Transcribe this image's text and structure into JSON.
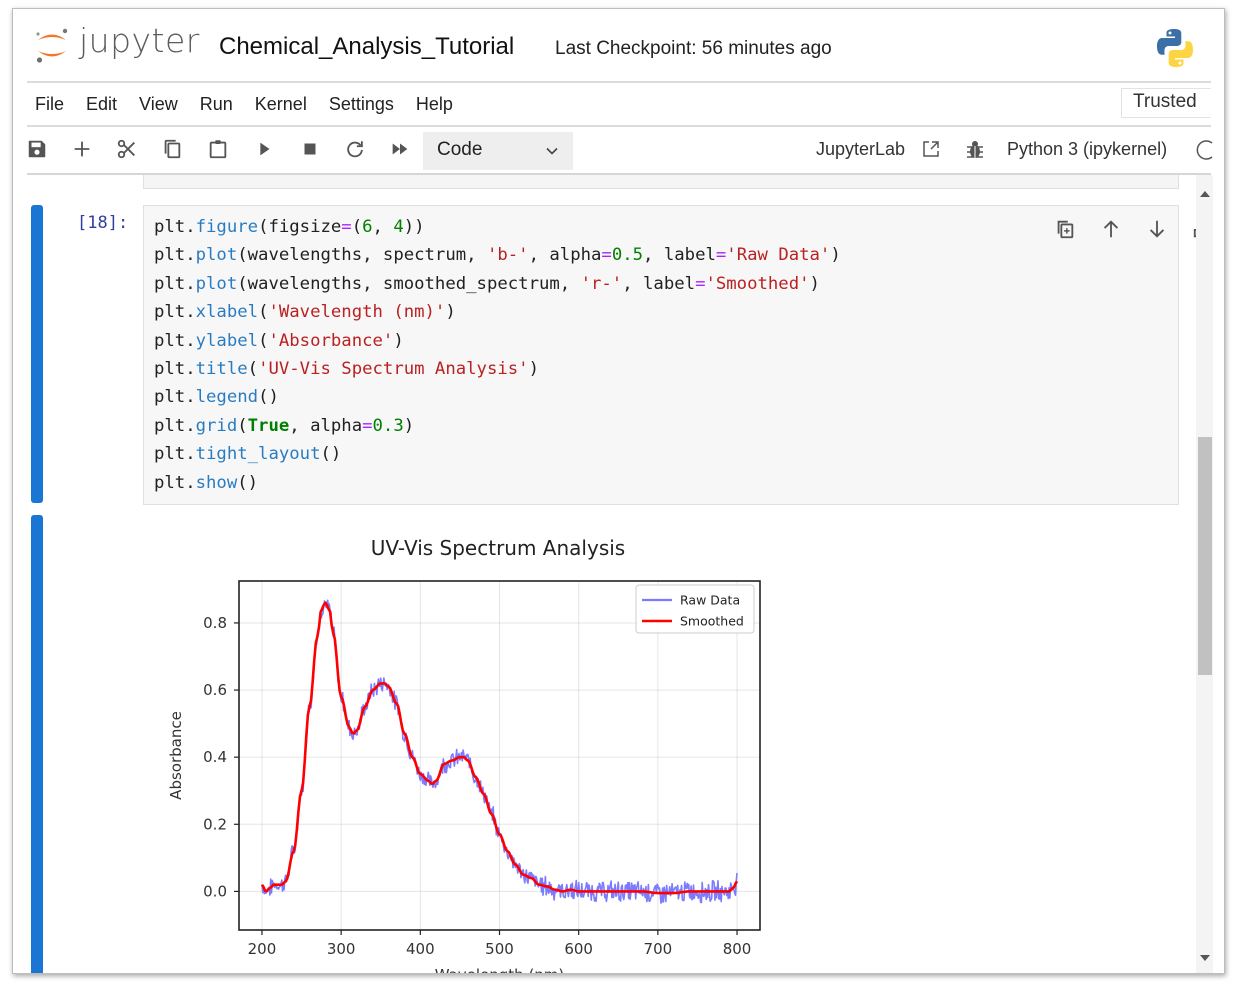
{
  "header": {
    "logo_word": "jupyter",
    "notebook_title": "Chemical_Analysis_Tutorial",
    "checkpoint": "Last Checkpoint: 56 minutes ago"
  },
  "menu": {
    "items": [
      "File",
      "Edit",
      "View",
      "Run",
      "Kernel",
      "Settings",
      "Help"
    ],
    "trusted_label": "Trusted"
  },
  "toolbar": {
    "icons": [
      "save-icon",
      "add-cell-icon",
      "cut-icon",
      "copy-icon",
      "paste-icon",
      "run-icon",
      "stop-icon",
      "restart-icon",
      "run-all-icon"
    ],
    "cell_type": "Code",
    "open_in_label": "JupyterLab",
    "kernel_name": "Python 3 (ipykernel)"
  },
  "cell": {
    "prompt": "[18]:",
    "tools": [
      "duplicate-cell-icon",
      "move-up-icon",
      "move-down-icon",
      "insert-above-icon",
      "insert-below-icon",
      "delete-cell-icon"
    ],
    "code_lines": [
      [
        [
          "plt.",
          "c-def"
        ],
        [
          "figure",
          "c-kw"
        ],
        [
          "(figsize",
          "c-def"
        ],
        [
          "=",
          "c-op"
        ],
        [
          "(",
          "c-def"
        ],
        [
          "6",
          "c-num"
        ],
        [
          ", ",
          "c-def"
        ],
        [
          "4",
          "c-num"
        ],
        [
          "))",
          "c-def"
        ]
      ],
      [
        [
          "plt.",
          "c-def"
        ],
        [
          "plot",
          "c-kw"
        ],
        [
          "(wavelengths, spectrum, ",
          "c-def"
        ],
        [
          "'b-'",
          "c-str"
        ],
        [
          ", alpha",
          "c-def"
        ],
        [
          "=",
          "c-op"
        ],
        [
          "0.5",
          "c-num"
        ],
        [
          ", label",
          "c-def"
        ],
        [
          "=",
          "c-op"
        ],
        [
          "'Raw Data'",
          "c-str"
        ],
        [
          ")",
          "c-def"
        ]
      ],
      [
        [
          "plt.",
          "c-def"
        ],
        [
          "plot",
          "c-kw"
        ],
        [
          "(wavelengths, smoothed_spectrum, ",
          "c-def"
        ],
        [
          "'r-'",
          "c-str"
        ],
        [
          ", label",
          "c-def"
        ],
        [
          "=",
          "c-op"
        ],
        [
          "'Smoothed'",
          "c-str"
        ],
        [
          ")",
          "c-def"
        ]
      ],
      [
        [
          "plt.",
          "c-def"
        ],
        [
          "xlabel",
          "c-kw"
        ],
        [
          "(",
          "c-def"
        ],
        [
          "'Wavelength (nm)'",
          "c-str"
        ],
        [
          ")",
          "c-def"
        ]
      ],
      [
        [
          "plt.",
          "c-def"
        ],
        [
          "ylabel",
          "c-kw"
        ],
        [
          "(",
          "c-def"
        ],
        [
          "'Absorbance'",
          "c-str"
        ],
        [
          ")",
          "c-def"
        ]
      ],
      [
        [
          "plt.",
          "c-def"
        ],
        [
          "title",
          "c-kw"
        ],
        [
          "(",
          "c-def"
        ],
        [
          "'UV-Vis Spectrum Analysis'",
          "c-str"
        ],
        [
          ")",
          "c-def"
        ]
      ],
      [
        [
          "plt.",
          "c-def"
        ],
        [
          "legend",
          "c-kw"
        ],
        [
          "()",
          "c-def"
        ]
      ],
      [
        [
          "plt.",
          "c-def"
        ],
        [
          "grid",
          "c-kw"
        ],
        [
          "(",
          "c-def"
        ],
        [
          "True",
          "c-bool"
        ],
        [
          ", alpha",
          "c-def"
        ],
        [
          "=",
          "c-op"
        ],
        [
          "0.3",
          "c-num"
        ],
        [
          ")",
          "c-def"
        ]
      ],
      [
        [
          "plt.",
          "c-def"
        ],
        [
          "tight_layout",
          "c-kw"
        ],
        [
          "()",
          "c-def"
        ]
      ],
      [
        [
          "plt.",
          "c-def"
        ],
        [
          "show",
          "c-kw"
        ],
        [
          "()",
          "c-def"
        ]
      ]
    ]
  },
  "colors": {
    "accent_blue": "#1976d2",
    "jupyter_orange": "#f37726",
    "raw_series": "#7b7bff",
    "smoothed_series": "#ff0000"
  },
  "chart_data": {
    "type": "line",
    "title": "UV-Vis Spectrum Analysis",
    "xlabel": "Wavelength (nm)",
    "ylabel": "Absorbance",
    "xlim": [
      171,
      829
    ],
    "ylim": [
      -0.115,
      0.925
    ],
    "xticks": [
      200,
      300,
      400,
      500,
      600,
      700,
      800
    ],
    "yticks": [
      0.0,
      0.2,
      0.4,
      0.6,
      0.8
    ],
    "ytick_labels": [
      "0.0",
      "0.2",
      "0.4",
      "0.6",
      "0.8"
    ],
    "grid": true,
    "legend_position": "upper-right",
    "series": [
      {
        "name": "Raw Data",
        "style": "noisy",
        "alpha": 0.5,
        "color": "#0000ff",
        "noise_amplitude": 0.025,
        "x": [
          200,
          205,
          210,
          215,
          220,
          225,
          230,
          240,
          250,
          260,
          270,
          275,
          280,
          285,
          290,
          300,
          310,
          315,
          320,
          330,
          340,
          350,
          355,
          360,
          370,
          380,
          390,
          400,
          410,
          415,
          420,
          430,
          440,
          450,
          455,
          460,
          470,
          480,
          490,
          500,
          510,
          520,
          530,
          540,
          550,
          560,
          570,
          580,
          590,
          600,
          620,
          640,
          660,
          680,
          700,
          720,
          740,
          760,
          780,
          790,
          795,
          800
        ],
        "y": [
          0.02,
          0.0,
          0.01,
          0.02,
          0.02,
          0.02,
          0.03,
          0.12,
          0.3,
          0.55,
          0.76,
          0.84,
          0.86,
          0.84,
          0.77,
          0.58,
          0.49,
          0.47,
          0.48,
          0.55,
          0.6,
          0.62,
          0.62,
          0.61,
          0.56,
          0.47,
          0.4,
          0.35,
          0.33,
          0.32,
          0.33,
          0.38,
          0.39,
          0.4,
          0.4,
          0.39,
          0.34,
          0.29,
          0.23,
          0.17,
          0.12,
          0.08,
          0.05,
          0.04,
          0.02,
          0.015,
          0.005,
          0.0,
          0.005,
          0.0,
          0.0,
          0.0,
          0.0,
          0.0,
          -0.005,
          -0.005,
          0.0,
          0.0,
          0.0,
          0.0,
          0.01,
          0.03
        ]
      },
      {
        "name": "Smoothed",
        "style": "smooth",
        "alpha": 1.0,
        "color": "#ff0000",
        "x": [
          200,
          205,
          210,
          215,
          220,
          225,
          230,
          240,
          250,
          260,
          270,
          275,
          280,
          285,
          290,
          300,
          310,
          315,
          320,
          330,
          340,
          350,
          355,
          360,
          370,
          380,
          390,
          400,
          410,
          415,
          420,
          430,
          440,
          450,
          455,
          460,
          470,
          480,
          490,
          500,
          510,
          520,
          530,
          540,
          550,
          560,
          570,
          580,
          590,
          600,
          620,
          640,
          660,
          680,
          700,
          720,
          740,
          760,
          780,
          790,
          795,
          800
        ],
        "y": [
          0.02,
          0.0,
          0.01,
          0.02,
          0.02,
          0.02,
          0.03,
          0.12,
          0.3,
          0.55,
          0.76,
          0.84,
          0.86,
          0.84,
          0.77,
          0.58,
          0.49,
          0.47,
          0.48,
          0.55,
          0.6,
          0.62,
          0.62,
          0.61,
          0.56,
          0.47,
          0.4,
          0.35,
          0.33,
          0.32,
          0.33,
          0.38,
          0.39,
          0.4,
          0.4,
          0.39,
          0.34,
          0.29,
          0.23,
          0.17,
          0.12,
          0.08,
          0.05,
          0.04,
          0.02,
          0.015,
          0.005,
          0.0,
          0.005,
          0.0,
          0.0,
          0.0,
          0.0,
          0.0,
          -0.005,
          -0.005,
          0.0,
          0.0,
          0.0,
          0.0,
          0.01,
          0.03
        ]
      }
    ]
  }
}
